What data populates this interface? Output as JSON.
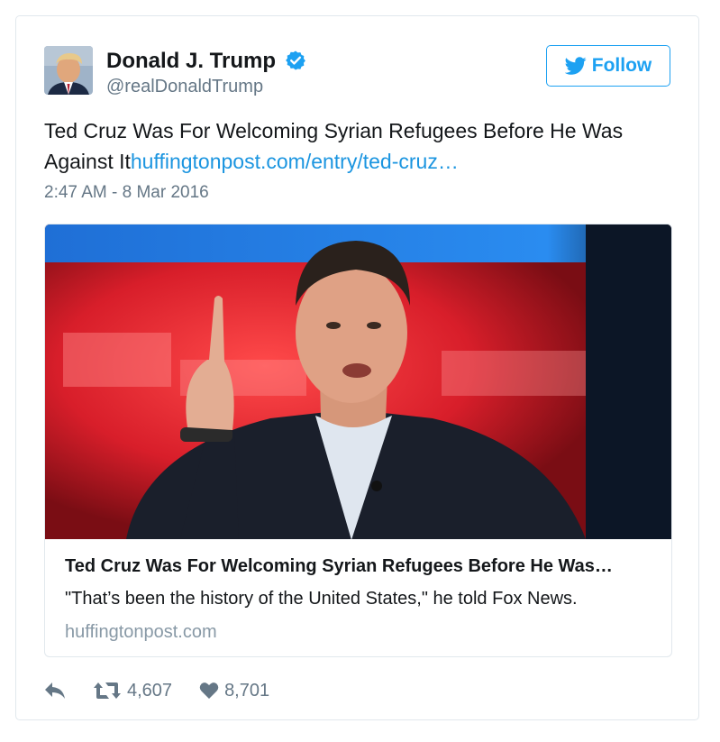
{
  "author": {
    "name": "Donald J. Trump",
    "handle": "@realDonaldTrump",
    "verified": true
  },
  "follow_button": {
    "label": "Follow"
  },
  "tweet": {
    "text": "Ted Cruz Was For Welcoming Syrian Refugees Before He Was Against It",
    "link_text": "huffingtonpost.com/entry/ted-cruz…",
    "timestamp": "2:47 AM - 8 Mar 2016"
  },
  "card": {
    "title": "Ted Cruz Was For Welcoming Syrian Refugees Before He Was…",
    "description": "\"That’s been the history of the United States,\" he told Fox News.",
    "domain": "huffingtonpost.com"
  },
  "actions": {
    "retweet_count": "4,607",
    "like_count": "8,701"
  },
  "colors": {
    "accent": "#1da1f2",
    "link": "#1b95e0",
    "muted": "#657786"
  },
  "icons": [
    "twitter-bird-icon",
    "verified-badge-icon",
    "reply-icon",
    "retweet-icon",
    "heart-icon"
  ]
}
